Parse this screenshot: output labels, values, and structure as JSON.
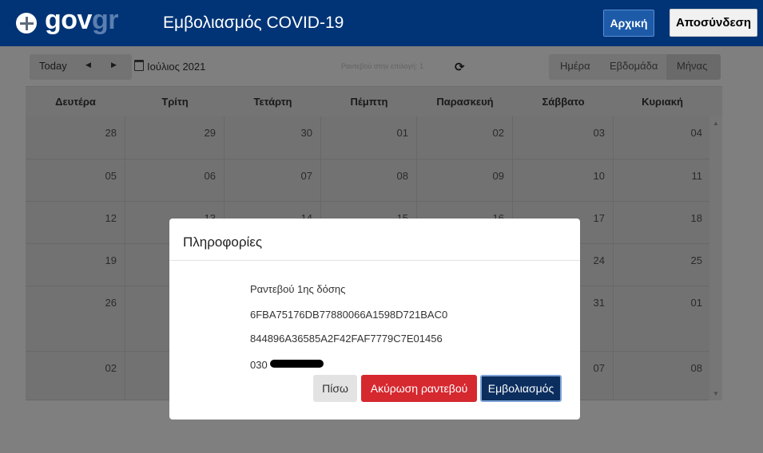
{
  "header": {
    "logo_gov": "gov",
    "logo_gr": "gr",
    "title": "Εμβολιασμός COVID-19",
    "home_label": "Αρχική",
    "logout_label": "Αποσύνδεση",
    "brand_color": "#003476"
  },
  "toolbar": {
    "today_label": "Today",
    "prev_icon": "◀",
    "next_icon": "▶",
    "month_label": "Ιούλιος 2021",
    "appointment_count": "Ραντεβού στην επιλογή: 1",
    "refresh_icon": "⟳",
    "views": [
      "Ημέρα",
      "Εβδομάδα",
      "Μήνας"
    ],
    "active_view": "Μήνας"
  },
  "calendar": {
    "weekdays": [
      "Δευτέρα",
      "Τρίτη",
      "Τετάρτη",
      "Πέμπτη",
      "Παρασκευή",
      "Σάββατο",
      "Κυριακή"
    ],
    "weeks": [
      [
        "28",
        "29",
        "30",
        "01",
        "02",
        "03",
        "04"
      ],
      [
        "05",
        "06",
        "07",
        "08",
        "09",
        "10",
        "11"
      ],
      [
        "12",
        "13",
        "14",
        "15",
        "16",
        "17",
        "18"
      ],
      [
        "19",
        "",
        "",
        "",
        "",
        "24",
        "25"
      ],
      [
        "26",
        "",
        "",
        "",
        "",
        "31",
        "01"
      ],
      [
        "02",
        "",
        "",
        "",
        "",
        "07",
        "08"
      ]
    ]
  },
  "modal": {
    "title": "Πληροφορίες",
    "line1": "Ραντεβού 1ης δόσης",
    "line2": "6FBA75176DB77880066A1598D721BAC0",
    "line3": "844896A36585A2F42FAF7779C7E01456",
    "line4_prefix": "030",
    "back_label": "Πίσω",
    "cancel_label": "Ακύρωση ραντεβού",
    "vaccinate_label": "Εμβολιασμός",
    "cancel_color": "#d6282f",
    "vaccinate_color": "#0b2e5f"
  }
}
